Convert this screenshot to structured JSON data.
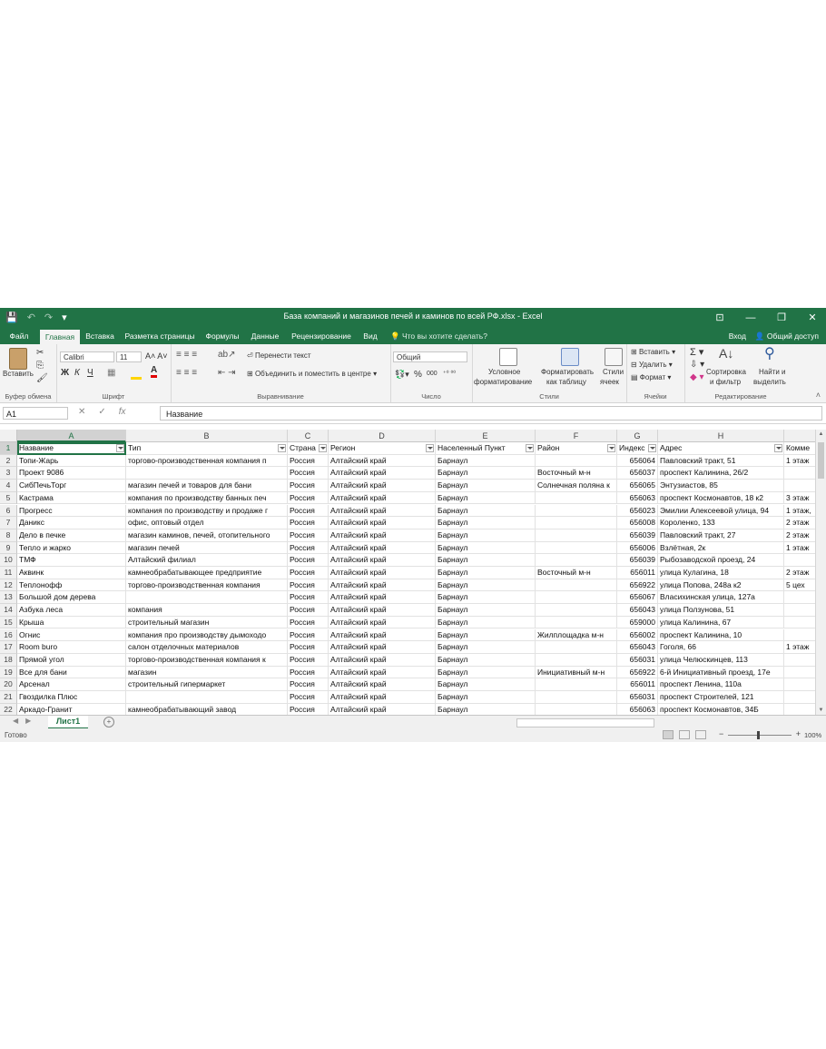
{
  "window": {
    "title": "База компаний и магазинов печей и каминов по всей РФ.xlsx - Excel",
    "qat": [
      "💾",
      "↶",
      "↷",
      "▾"
    ]
  },
  "tabs": [
    "Файл",
    "Главная",
    "Вставка",
    "Разметка страницы",
    "Формулы",
    "Данные",
    "Рецензирование",
    "Вид"
  ],
  "tellme": "Что вы хотите сделать?",
  "account": {
    "signin": "Вход",
    "share": "Общий доступ"
  },
  "ribbon": {
    "clipboard": {
      "paste": "Вставить",
      "label": "Буфер обмена"
    },
    "font": {
      "name": "Calibri",
      "size": "11",
      "bold": "Ж",
      "italic": "К",
      "underline": "Ч",
      "label": "Шрифт"
    },
    "alignment": {
      "wrap": "Перенести текст",
      "merge": "Объединить и поместить в центре",
      "label": "Выравнивание"
    },
    "number": {
      "format": "Общий",
      "percent": "%",
      "thousands": "000",
      "label": "Число"
    },
    "styles": {
      "conditional1": "Условное",
      "conditional2": "форматирование",
      "table1": "Форматировать",
      "table2": "как таблицу",
      "cell1": "Стили",
      "cell2": "ячеек",
      "label": "Стили"
    },
    "cells": {
      "insert": "Вставить",
      "delete": "Удалить",
      "format": "Формат",
      "label": "Ячейки"
    },
    "editing": {
      "sort1": "Сортировка",
      "sort2": "и фильтр",
      "find1": "Найти и",
      "find2": "выделить",
      "label": "Редактирование"
    }
  },
  "formula_bar": {
    "name_box": "A1",
    "fx": "fx",
    "content": "Название"
  },
  "columns": [
    {
      "letter": "A",
      "header": "Название"
    },
    {
      "letter": "B",
      "header": "Тип"
    },
    {
      "letter": "C",
      "header": "Страна"
    },
    {
      "letter": "D",
      "header": "Регион"
    },
    {
      "letter": "E",
      "header": "Населенный Пункт"
    },
    {
      "letter": "F",
      "header": "Район"
    },
    {
      "letter": "G",
      "header": "Индекс"
    },
    {
      "letter": "H",
      "header": "Адрес"
    },
    {
      "letter": "",
      "header": "Комме"
    }
  ],
  "rows": [
    [
      "Топи-Жарь",
      "торгово-производственная компания п",
      "Россия",
      "Алтайский край",
      "Барнаул",
      "",
      "656064",
      "Павловский тракт, 51",
      "1 этаж"
    ],
    [
      "Проект 9086",
      "",
      "Россия",
      "Алтайский край",
      "Барнаул",
      "Восточный м-н",
      "656037",
      "проспект Калинина, 26/2",
      ""
    ],
    [
      "СибПечьТорг",
      "магазин печей и товаров для бани",
      "Россия",
      "Алтайский край",
      "Барнаул",
      "Солнечная поляна к",
      "656065",
      "Энтузиастов, 85",
      ""
    ],
    [
      "Кастрама",
      "компания по производству банных печ",
      "Россия",
      "Алтайский край",
      "Барнаул",
      "",
      "656063",
      "проспект Космонавтов, 18 к2",
      "3 этаж"
    ],
    [
      "Прогресс",
      "компания по производству и продаже г",
      "Россия",
      "Алтайский край",
      "Барнаул",
      "",
      "656023",
      "Эмилии Алексеевой улица, 94",
      "1 этаж,"
    ],
    [
      "Даникс",
      "офис, оптовый отдел",
      "Россия",
      "Алтайский край",
      "Барнаул",
      "",
      "656008",
      "Короленко, 133",
      "2 этаж"
    ],
    [
      "Дело в печке",
      "магазин каминов, печей, отопительного",
      "Россия",
      "Алтайский край",
      "Барнаул",
      "",
      "656039",
      "Павловский тракт, 27",
      "2 этаж"
    ],
    [
      "Тепло и жарко",
      "магазин печей",
      "Россия",
      "Алтайский край",
      "Барнаул",
      "",
      "656006",
      "Взлётная, 2к",
      "1 этаж"
    ],
    [
      "ТМФ",
      "Алтайский филиал",
      "Россия",
      "Алтайский край",
      "Барнаул",
      "",
      "656039",
      "Рыбозаводской проезд, 24",
      ""
    ],
    [
      "Аквинк",
      "камнеобрабатывающее предприятие",
      "Россия",
      "Алтайский край",
      "Барнаул",
      "Восточный м-н",
      "656011",
      "улица Кулагина, 18",
      "2 этаж"
    ],
    [
      "Теплонофф",
      "торгово-производственная компания",
      "Россия",
      "Алтайский край",
      "Барнаул",
      "",
      "656922",
      "улица Попова, 248а к2",
      "5 цех"
    ],
    [
      "Большой дом дерева",
      "",
      "Россия",
      "Алтайский край",
      "Барнаул",
      "",
      "656067",
      "Власихинская улица, 127а",
      ""
    ],
    [
      "Азбука леса",
      "компания",
      "Россия",
      "Алтайский край",
      "Барнаул",
      "",
      "656043",
      "улица Ползунова, 51",
      ""
    ],
    [
      "Крыша",
      "строительный магазин",
      "Россия",
      "Алтайский край",
      "Барнаул",
      "",
      "659000",
      "улица Калинина, 67",
      ""
    ],
    [
      "Огнис",
      "компания про производству дымоходо",
      "Россия",
      "Алтайский край",
      "Барнаул",
      "Жилплощадка м-н",
      "656002",
      "проспект Калинина, 10",
      ""
    ],
    [
      "Room buro",
      "салон отделочных материалов",
      "Россия",
      "Алтайский край",
      "Барнаул",
      "",
      "656043",
      "Гоголя, 66",
      "1 этаж"
    ],
    [
      "Прямой угол",
      "торгово-производственная компания к",
      "Россия",
      "Алтайский край",
      "Барнаул",
      "",
      "656031",
      "улица Челюскинцев, 113",
      ""
    ],
    [
      "Все для бани",
      "магазин",
      "Россия",
      "Алтайский край",
      "Барнаул",
      "Инициативный м-н",
      "656922",
      "6-й Инициативный проезд, 17е",
      ""
    ],
    [
      "Арсенал",
      "строительный гипермаркет",
      "Россия",
      "Алтайский край",
      "Барнаул",
      "",
      "656011",
      "проспект Ленина, 110а",
      ""
    ],
    [
      "Гвоздилка Плюс",
      "",
      "Россия",
      "Алтайский край",
      "Барнаул",
      "",
      "656031",
      "проспект Строителей, 121",
      ""
    ],
    [
      "Аркадо-Гранит",
      "камнеобрабатывающий завод",
      "Россия",
      "Алтайский край",
      "Барнаул",
      "",
      "656063",
      "проспект Космонавтов, 34Б",
      ""
    ]
  ],
  "sheet": {
    "name": "Лист1",
    "add": "+"
  },
  "status": {
    "ready": "Готово",
    "zoom": "100%"
  }
}
